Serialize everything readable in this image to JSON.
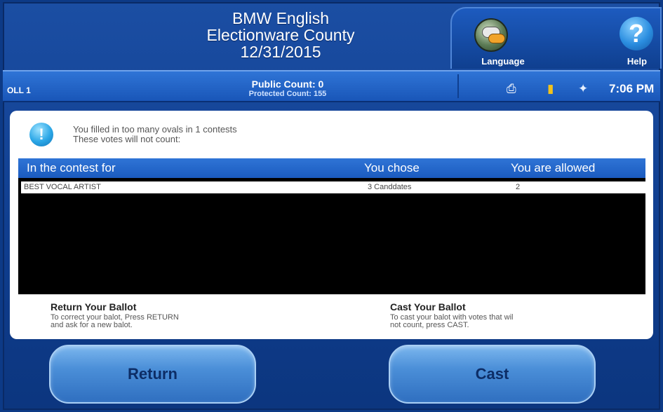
{
  "header": {
    "title_line1": "BMW English",
    "title_line2": "Electionware County",
    "title_line3": "12/31/2015",
    "language_label": "Language",
    "help_label": "Help"
  },
  "status": {
    "poll": "OLL 1",
    "public_count": "Public Count: 0",
    "protected_count": "Protected Count: 155",
    "time": "7:06 PM"
  },
  "warning": {
    "line1": "You filled in too many ovals in 1 contests",
    "line2": "These votes will not count:"
  },
  "table": {
    "headers": [
      "In the contest for",
      "You chose",
      "You are allowed"
    ],
    "rows": [
      {
        "contest": "BEST VOCAL ARTIST",
        "chose": "3 Canddates",
        "allowed": "2"
      }
    ]
  },
  "info": {
    "return_title": "Return Your Ballot",
    "return_line1": "To correct your balot, Press RETURN",
    "return_line2": "and ask for a new balot.",
    "cast_title": "Cast Your Ballot",
    "cast_line1": "To cast your balot with votes that wil",
    "cast_line2": "not count, press CAST."
  },
  "buttons": {
    "return": "Return",
    "cast": "Cast"
  },
  "icons": {
    "language": "speech-bubbles-icon",
    "help": "question-mark-icon",
    "warning": "exclamation-icon",
    "status1": "printer-icon",
    "status2": "battery-icon",
    "status3": "power-plug-icon"
  },
  "colors": {
    "background": "#0d3a86",
    "status_bar": "#2f74d6",
    "button": "#4b8fd8",
    "table_header": "#1b5bbf"
  }
}
